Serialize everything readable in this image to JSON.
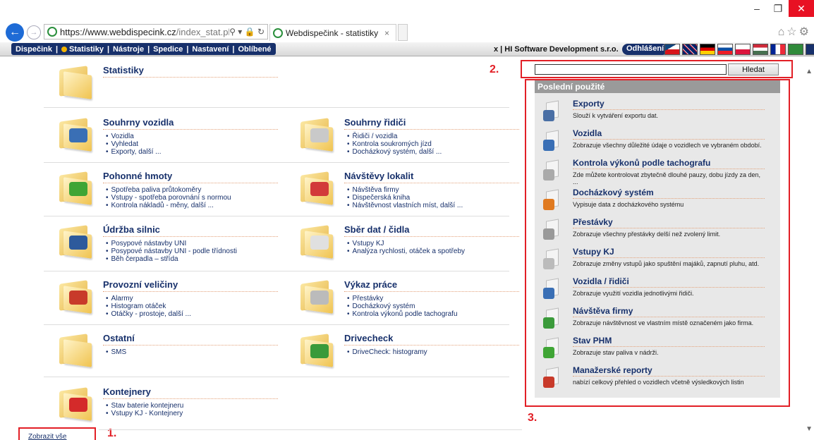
{
  "browser": {
    "url_main": "https://www.webdispecink.cz",
    "url_path": "/index_stat.php",
    "addr_icons": "⚲ ▾ 🔒 ↻",
    "tab_title": "Webdispečink - statistiky",
    "tab_close": "×",
    "back_icon": "←",
    "forward_icon": "→",
    "window_controls": {
      "minimize": "–",
      "restore": "❐",
      "close": "✕"
    },
    "toolbar_icons": "⌂☆⚙"
  },
  "menubar": {
    "items": [
      "Dispečink",
      "Statistiky",
      "Nástroje",
      "Spedice",
      "Nastavení",
      "Oblíbené"
    ],
    "separator": "|",
    "company": "x  |  HI Software Development s.r.o.",
    "logout": "Odhlášení"
  },
  "categories": [
    {
      "title": "Statistiky",
      "items": [],
      "badge_color": ""
    },
    {
      "title": "Souhrny vozidla",
      "items": [
        "Vozidla",
        "Vyhledat",
        "Exporty, další ..."
      ],
      "badge_color": "#3a6fb5"
    },
    {
      "title": "Souhrny řidiči",
      "items": [
        "Řidiči / vozidla",
        "Kontrola soukromých jízd",
        "Docházkový systém, další ..."
      ],
      "badge_color": "#c9c9c9"
    },
    {
      "title": "Pohonné hmoty",
      "items": [
        "Spotřeba paliva průtokoměry",
        "Vstupy - spotřeba porovnání s normou",
        "Kontrola nákladů - měny, další ..."
      ],
      "badge_color": "#3fa535"
    },
    {
      "title": "Návštěvy lokalit",
      "items": [
        "Návštěva firmy",
        "Dispečerská kniha",
        "Návštěvnost vlastních míst, další ..."
      ],
      "badge_color": "#d23a3a"
    },
    {
      "title": "Údržba silnic",
      "items": [
        "Posypové nástavby UNI",
        "Posypové nástavby UNI - podle třídnosti",
        "Běh čerpadla – střída"
      ],
      "badge_color": "#2d5a9c"
    },
    {
      "title": "Sběr dat / čidla",
      "items": [
        "Vstupy KJ",
        "Analýza rychlosti, otáček a spotřeby"
      ],
      "badge_color": "#e0e0e0"
    },
    {
      "title": "Provozní veličiny",
      "items": [
        "Alarmy",
        "Histogram otáček",
        "Otáčky - prostoje, další ..."
      ],
      "badge_color": "#c83a2a"
    },
    {
      "title": "Výkaz práce",
      "items": [
        "Přestávky",
        "Docházkový systém",
        "Kontrola výkonů podle tachografu"
      ],
      "badge_color": "#bbbbbb"
    },
    {
      "title": "Ostatní",
      "items": [
        "SMS"
      ],
      "badge_color": ""
    },
    {
      "title": "Drivecheck",
      "items": [
        "DriveCheck: histogramy"
      ],
      "badge_color": "#3a9a3a"
    },
    {
      "title": "Kontejnery",
      "items": [
        "Stav baterie kontejneru",
        "Vstupy KJ - Kontejnery"
      ],
      "badge_color": "#d42a2a"
    }
  ],
  "search": {
    "button": "Hledat",
    "value": ""
  },
  "recent": {
    "heading": "Poslední použité",
    "items": [
      {
        "title": "Exporty",
        "desc": "Slouží k vytváření exportu dat.",
        "color": "#4a6fa5"
      },
      {
        "title": "Vozidla",
        "desc": "Zobrazuje všechny důležité údaje o vozidlech ve vybraném období.",
        "color": "#3a6fb5"
      },
      {
        "title": "Kontrola výkonů podle tachografu",
        "desc": "Zde můžete kontrolovat zbytečně dlouhé pauzy, dobu jízdy za den,",
        "desc2": "...",
        "color": "#aaaaaa"
      },
      {
        "title": "Docházkový systém",
        "desc": "Vypisuje data z docházkového systému",
        "color": "#e07a20"
      },
      {
        "title": "Přestávky",
        "desc": "Zobrazuje všechny přestávky delší než zvolený limit.",
        "color": "#999999"
      },
      {
        "title": "Vstupy KJ",
        "desc": "Zobrazuje změny vstupů jako spuštění majáků, zapnutí pluhu, atd.",
        "color": "#bbbbbb"
      },
      {
        "title": "Vozidla / řidiči",
        "desc": "Zobrazuje využití vozidla jednotlivými řidiči.",
        "color": "#3a6fb5"
      },
      {
        "title": "Návštěva firmy",
        "desc": "Zobrazuje návštěvnost ve vlastním místě označeném jako firma.",
        "color": "#3a9a3a"
      },
      {
        "title": "Stav PHM",
        "desc": "Zobrazuje stav paliva v nádrži.",
        "color": "#3fa535"
      },
      {
        "title": "Manažerské reporty",
        "desc": "nabízí celkový přehled o vozidlech včetně výsledkových listin",
        "color": "#c83a2a"
      }
    ]
  },
  "annotations": [
    "1.",
    "2.",
    "3."
  ],
  "footer": {
    "show_all": "Zobrazit vše"
  }
}
